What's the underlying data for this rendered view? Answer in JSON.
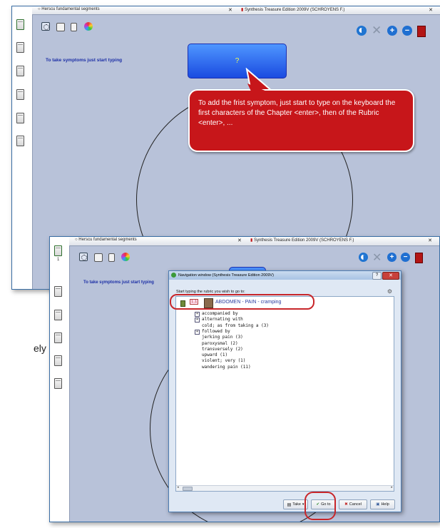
{
  "top_window": {
    "tabs": [
      {
        "label": "Herscu fundamental segments"
      },
      {
        "label": "Synthesis Treasure Edition 2009V (SCHROYENS F.)"
      }
    ],
    "hint": "To take symptoms just start typing",
    "question_label": "?",
    "callout": "To add the frist symptom, just start to type on the keyboard the first characters of the Chapter <enter>, then of the Rubric <enter>, ..."
  },
  "bottom_window": {
    "tabs": [
      {
        "label": "Herscu fundamental segments"
      },
      {
        "label": "Synthesis Treasure Edition 2009V (SCHROYENS F.)"
      }
    ],
    "hint": "To take symptoms just start typing",
    "side_badge": "1"
  },
  "side_text": "ely",
  "dialog": {
    "title": "Navigation window (Synthesis Treasure Edition 2009V)",
    "prompt": "Start typing the rubric you wish to go to:",
    "path_badge": "1.1",
    "path": "ABDOMEN - PAIN - cramping",
    "items": [
      {
        "label": "accompanied by",
        "expandable": true
      },
      {
        "label": "alternating with",
        "expandable": true
      },
      {
        "label": "cold; as from taking a (3)",
        "expandable": false
      },
      {
        "label": "followed by",
        "expandable": true
      },
      {
        "label": "jerking pain (3)",
        "expandable": false
      },
      {
        "label": "paroxysmal (2)",
        "expandable": false
      },
      {
        "label": "transversely (2)",
        "expandable": false
      },
      {
        "label": "upward (1)",
        "expandable": false
      },
      {
        "label": "violent; very (1)",
        "expandable": false
      },
      {
        "label": "wandering pain (11)",
        "expandable": false
      }
    ],
    "buttons": {
      "take": "Take",
      "goto": "Go to",
      "cancel": "Cancel",
      "help": "Help"
    }
  },
  "colors": {
    "background": "#b8c2d9",
    "hint_text": "#1c2fa6",
    "callout": "#c7161a",
    "highlight_ring": "#c8262a"
  }
}
